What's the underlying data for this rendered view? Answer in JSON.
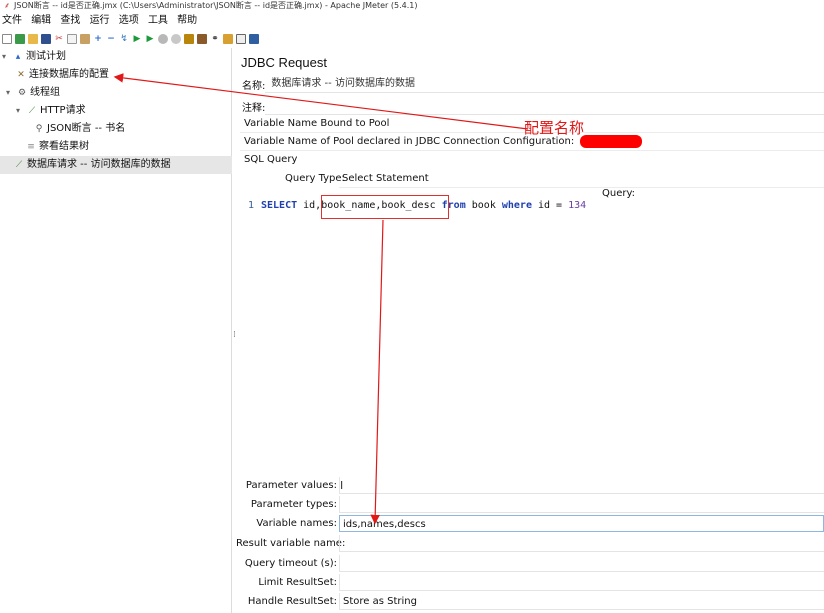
{
  "window": {
    "title": "JSON断言 -- id是否正确.jmx (C:\\Users\\Administrator\\JSON断言 -- id是否正确.jmx) - Apache JMeter (5.4.1)"
  },
  "menu": [
    "文件",
    "编辑",
    "查找",
    "运行",
    "选项",
    "工具",
    "帮助"
  ],
  "toolbar_icons": [
    "new-icon",
    "templates-icon",
    "open-icon",
    "save-icon",
    "cut-icon",
    "copy-icon",
    "paste-icon",
    "expand-icon",
    "collapse-icon",
    "toggle-icon",
    "start-icon",
    "start-no-pause-icon",
    "stop-icon",
    "shutdown-icon",
    "clear-icon",
    "clear-all-icon",
    "search-icon",
    "reset-search-icon",
    "function-helper-icon",
    "help-icon"
  ],
  "tree": {
    "test_plan": "测试计划",
    "jdbc_config": "连接数据库的配置",
    "thread_group": "线程组",
    "http_request": "HTTP请求",
    "json_assertion": "JSON断言 -- 书名",
    "results_tree": "察看结果树",
    "jdbc_request": "数据库请求 -- 访问数据库的数据"
  },
  "panel": {
    "title": "JDBC Request",
    "name_label": "名称:",
    "name_value": "数据库请求 -- 访问数据库的数据",
    "comment_label": "注释:",
    "comment_value": "",
    "pool_section_label": "Variable Name Bound to Pool",
    "pool_name_label": "Variable Name of Pool declared in JDBC Connection Configuration:",
    "sql_section_label": "SQL Query",
    "query_type_label": "Query Type:",
    "query_type_value": "Select Statement",
    "query_label": "Query:",
    "line_number": "1",
    "sql": {
      "select": "SELECT",
      "id": " id,",
      "cols": "book_name,book_desc",
      "from": "from",
      "table": " book ",
      "where": "where",
      "cond": " id = ",
      "value": "134"
    }
  },
  "params": {
    "parameter_values_label": "Parameter values:",
    "parameter_values": "",
    "parameter_types_label": "Parameter types:",
    "parameter_types": "",
    "variable_names_label": "Variable names:",
    "variable_names": "ids,names,descs",
    "result_variable_label": "Result variable name:",
    "result_variable": "",
    "query_timeout_label": "Query timeout (s):",
    "query_timeout": "",
    "limit_resultset_label": "Limit ResultSet:",
    "limit_resultset": "",
    "handle_resultset_label": "Handle ResultSet:",
    "handle_resultset": "Store as String"
  },
  "annotation": {
    "text": "配置名称",
    "color": "#e01818"
  }
}
